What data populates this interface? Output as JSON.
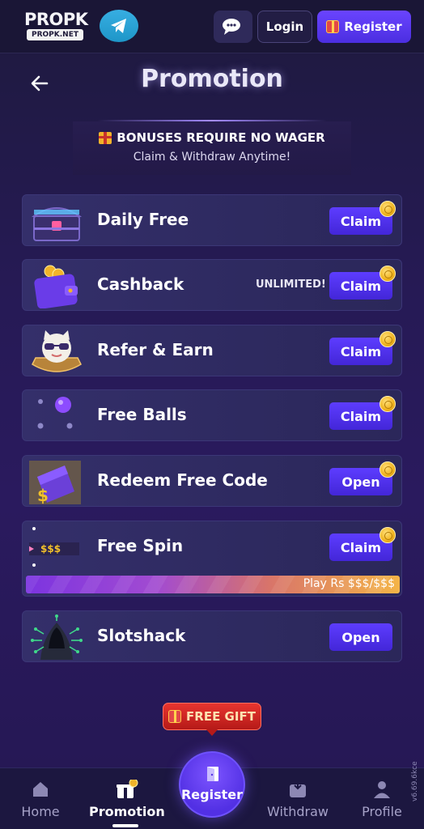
{
  "header": {
    "logo_main": "PROPK",
    "logo_sub": "PROPK.NET",
    "login_label": "Login",
    "register_label": "Register"
  },
  "page": {
    "title": "Promotion",
    "notice_line1": "BONUSES REQUIRE NO WAGER",
    "notice_line2": "Claim & Withdraw Anytime!"
  },
  "promotions": [
    {
      "title": "Daily Free",
      "button": "Claim",
      "icon": "treasure-chest-icon"
    },
    {
      "title": "Cashback",
      "button": "Claim",
      "badge": "UNLIMITED!",
      "icon": "wallet-icon"
    },
    {
      "title": "Refer & Earn",
      "button": "Claim",
      "icon": "lucky-cat-icon"
    },
    {
      "title": "Free Balls",
      "button": "Claim",
      "icon": "plinko-ball-icon"
    },
    {
      "title": "Redeem Free Code",
      "button": "Open",
      "icon": "ticket-icon"
    },
    {
      "title": "Free Spin",
      "button": "Claim",
      "icon": "spin-pointer-icon",
      "progress_text": "Play Rs $$$/$$$",
      "icon_text": "$$$"
    },
    {
      "title": "Slotshack",
      "button": "Open",
      "icon": "hacker-icon"
    }
  ],
  "free_gift_label": "FREE GIFT",
  "bottom_nav": {
    "home": "Home",
    "promotion": "Promotion",
    "register": "Register",
    "withdraw": "Withdraw",
    "profile": "Profile"
  },
  "version": "v6.69.6kce",
  "colors": {
    "accent": "#5d3dff",
    "background": "#1b1538",
    "free_gift": "#e8352f",
    "coin": "#f0b21c"
  }
}
